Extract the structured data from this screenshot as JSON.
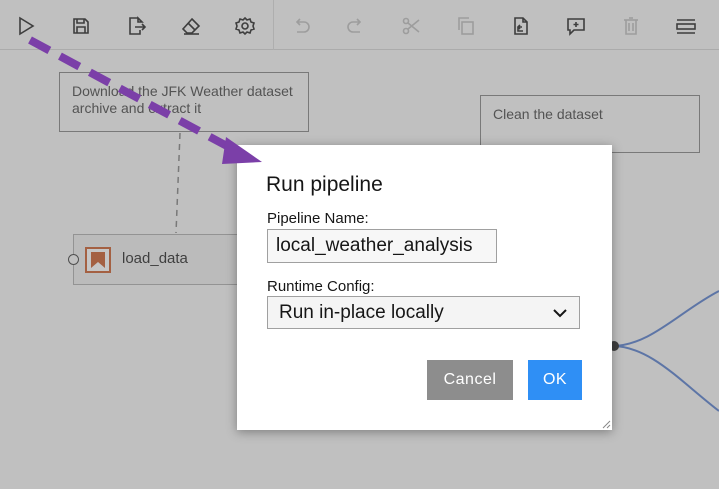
{
  "toolbar": {
    "buttons": [
      {
        "name": "run-icon",
        "enabled": true
      },
      {
        "name": "save-icon",
        "enabled": true
      },
      {
        "name": "export-icon",
        "enabled": true
      },
      {
        "name": "clear-icon",
        "enabled": true
      },
      {
        "name": "settings-icon",
        "enabled": true
      },
      {
        "name": "undo-icon",
        "enabled": false
      },
      {
        "name": "redo-icon",
        "enabled": false
      },
      {
        "name": "cut-icon",
        "enabled": false
      },
      {
        "name": "copy-icon",
        "enabled": false
      },
      {
        "name": "paste-icon",
        "enabled": true
      },
      {
        "name": "add-comment-icon",
        "enabled": true
      },
      {
        "name": "delete-icon",
        "enabled": false
      },
      {
        "name": "layout-icon",
        "enabled": true
      }
    ]
  },
  "canvas": {
    "comment_jfk": "Download the JFK Weather dataset archive and extract it",
    "comment_clean": "Clean the dataset",
    "node_label": "load_data"
  },
  "dialog": {
    "title": "Run pipeline",
    "name_label": "Pipeline Name:",
    "name_value": "local_weather_analysis",
    "runtime_label": "Runtime Config:",
    "runtime_value": "Run in-place locally",
    "cancel_label": "Cancel",
    "ok_label": "OK"
  },
  "colors": {
    "ok_button": "#2f8ff5",
    "cancel_button": "#8d8d8d",
    "annotation_arrow": "#7b3fa8",
    "edge_lines": "#4a74c9",
    "node_icon": "#c4501d"
  }
}
